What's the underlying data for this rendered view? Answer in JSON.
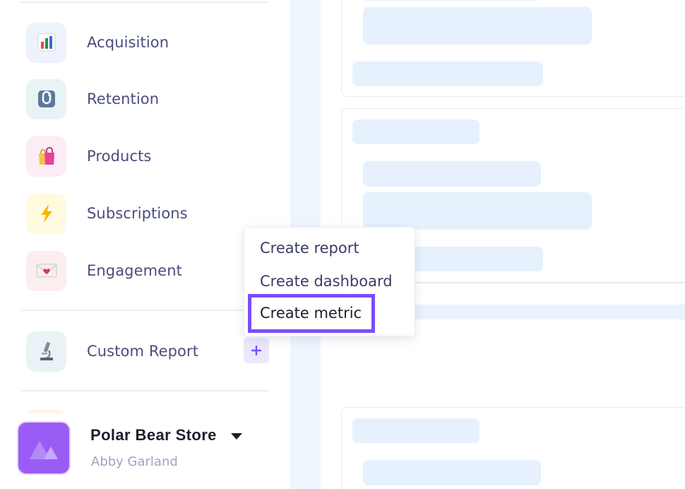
{
  "sidebar": {
    "nav_items": [
      {
        "label": "Acquisition",
        "icon": "bar-chart-icon",
        "icon_bg": "#eef2fd"
      },
      {
        "label": "Retention",
        "icon": "retention-loop-icon",
        "icon_bg": "#e9f2f5"
      },
      {
        "label": "Products",
        "icon": "shopping-bags-icon",
        "icon_bg": "#fdebf6"
      },
      {
        "label": "Subscriptions",
        "icon": "lightning-icon",
        "icon_bg": "#fffae0"
      },
      {
        "label": "Engagement",
        "icon": "love-letter-icon",
        "icon_bg": "#fdeeee"
      }
    ],
    "custom_report": {
      "label": "Custom Report",
      "icon": "microscope-icon",
      "add_label": "+"
    }
  },
  "store": {
    "name": "Polar Bear Store",
    "user": "Abby Garland"
  },
  "menu": {
    "items": [
      {
        "label": "Create report"
      },
      {
        "label": "Create dashboard"
      },
      {
        "label": "Create metric",
        "highlighted": true
      }
    ]
  },
  "colors": {
    "accent": "#7d4dfa",
    "store_avatar": "#9b5cf6",
    "skeleton": "#e6f1fd"
  }
}
